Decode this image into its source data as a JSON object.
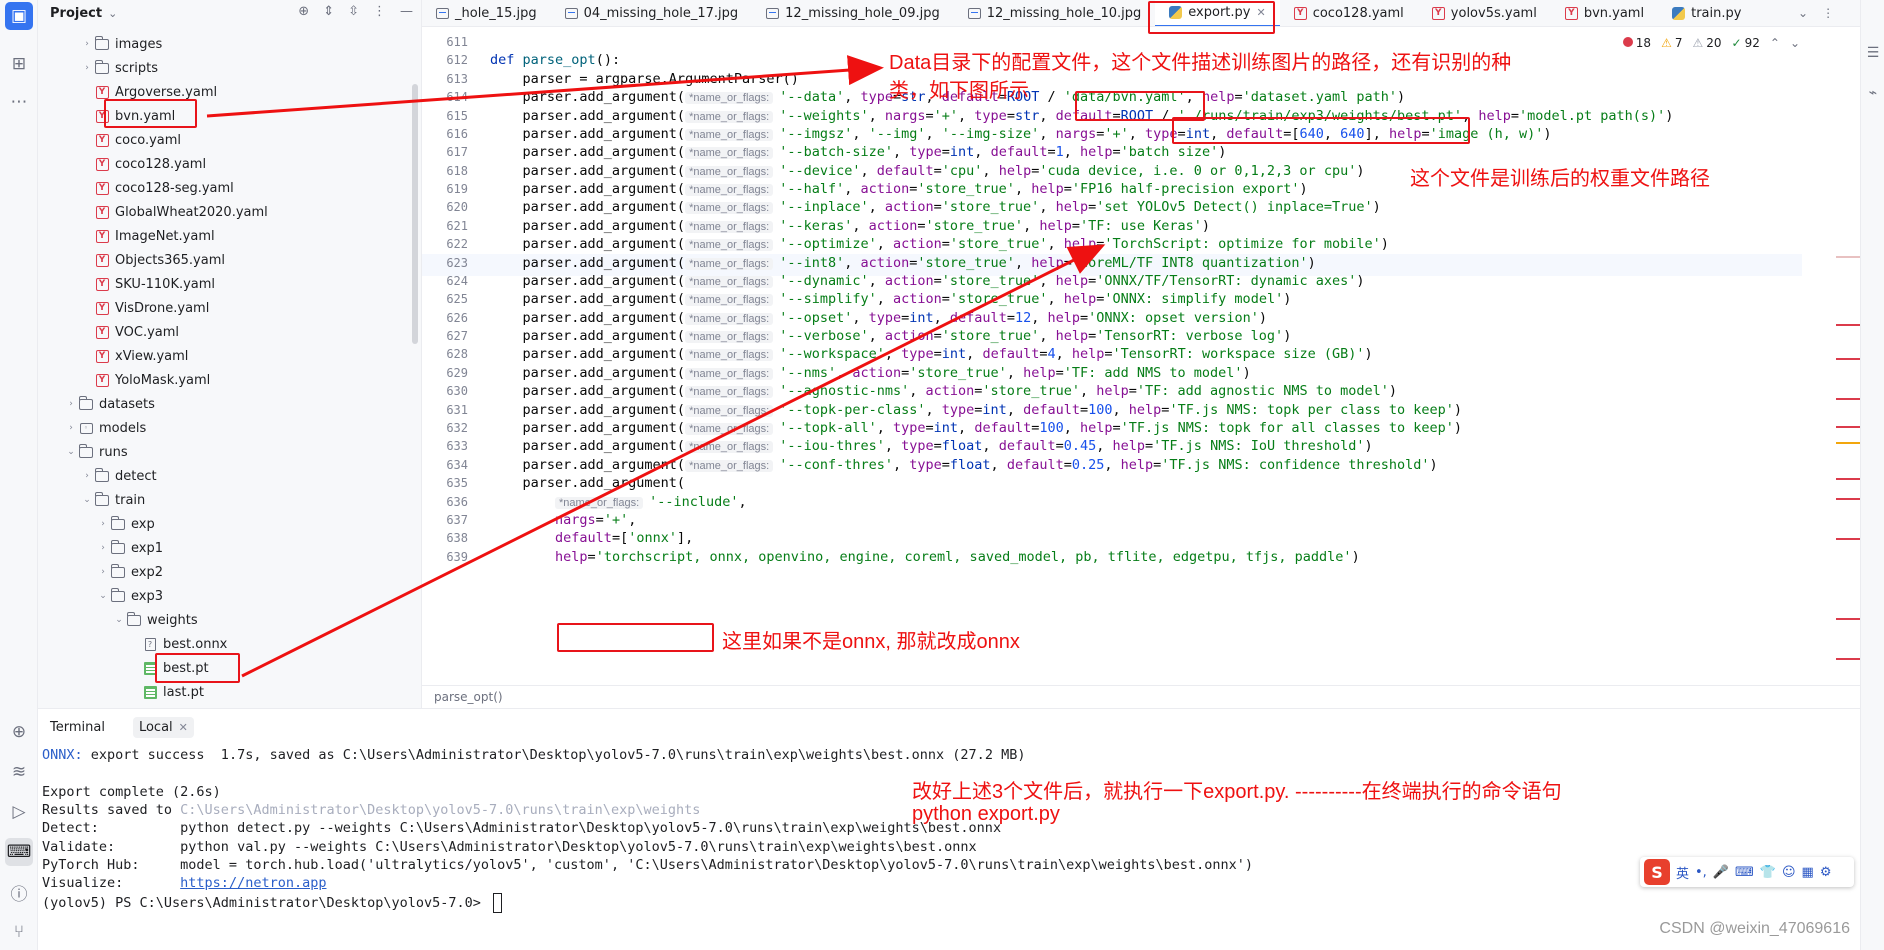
{
  "colors": {
    "accent": "#3574f0",
    "annotation": "#ee1111",
    "error": "#db3b4b",
    "warning": "#f2a60d",
    "ok": "#208a3c"
  },
  "project": {
    "title": "Project",
    "tree": [
      {
        "label": "images",
        "type": "folder",
        "depth": 3,
        "arrow": "›"
      },
      {
        "label": "scripts",
        "type": "folder",
        "depth": 3,
        "arrow": "›"
      },
      {
        "label": "Argoverse.yaml",
        "type": "yaml",
        "depth": 3
      },
      {
        "label": "bvn.yaml",
        "type": "yaml",
        "depth": 3
      },
      {
        "label": "coco.yaml",
        "type": "yaml",
        "depth": 3
      },
      {
        "label": "coco128.yaml",
        "type": "yaml",
        "depth": 3
      },
      {
        "label": "coco128-seg.yaml",
        "type": "yaml",
        "depth": 3
      },
      {
        "label": "GlobalWheat2020.yaml",
        "type": "yaml",
        "depth": 3
      },
      {
        "label": "ImageNet.yaml",
        "type": "yaml",
        "depth": 3
      },
      {
        "label": "Objects365.yaml",
        "type": "yaml",
        "depth": 3
      },
      {
        "label": "SKU-110K.yaml",
        "type": "yaml",
        "depth": 3
      },
      {
        "label": "VisDrone.yaml",
        "type": "yaml",
        "depth": 3
      },
      {
        "label": "VOC.yaml",
        "type": "yaml",
        "depth": 3
      },
      {
        "label": "xView.yaml",
        "type": "yaml",
        "depth": 3
      },
      {
        "label": "YoloMask.yaml",
        "type": "yaml",
        "depth": 3
      },
      {
        "label": "datasets",
        "type": "folder",
        "depth": 2,
        "arrow": "›"
      },
      {
        "label": "models",
        "type": "module",
        "depth": 2,
        "arrow": "›"
      },
      {
        "label": "runs",
        "type": "folder",
        "depth": 2,
        "arrow": "⌄"
      },
      {
        "label": "detect",
        "type": "folder",
        "depth": 3,
        "arrow": "›"
      },
      {
        "label": "train",
        "type": "folder",
        "depth": 3,
        "arrow": "⌄"
      },
      {
        "label": "exp",
        "type": "folder",
        "depth": 4,
        "arrow": "›"
      },
      {
        "label": "exp1",
        "type": "folder",
        "depth": 4,
        "arrow": "›"
      },
      {
        "label": "exp2",
        "type": "folder",
        "depth": 4,
        "arrow": "›"
      },
      {
        "label": "exp3",
        "type": "folder",
        "depth": 4,
        "arrow": "⌄"
      },
      {
        "label": "weights",
        "type": "folder",
        "depth": 5,
        "arrow": "⌄"
      },
      {
        "label": "best.onnx",
        "type": "unknown",
        "depth": 6
      },
      {
        "label": "best.pt",
        "type": "pt",
        "depth": 6
      },
      {
        "label": "last.pt",
        "type": "pt",
        "depth": 6
      }
    ]
  },
  "tabs": [
    {
      "label": "_hole_15.jpg",
      "icon": "image-icon"
    },
    {
      "label": "04_missing_hole_17.jpg",
      "icon": "image-icon"
    },
    {
      "label": "12_missing_hole_09.jpg",
      "icon": "image-icon"
    },
    {
      "label": "12_missing_hole_10.jpg",
      "icon": "image-icon"
    },
    {
      "label": "export.py",
      "icon": "python-icon",
      "active": true
    },
    {
      "label": "coco128.yaml",
      "icon": "yaml-icon"
    },
    {
      "label": "yolov5s.yaml",
      "icon": "yaml-icon"
    },
    {
      "label": "bvn.yaml",
      "icon": "yaml-icon"
    },
    {
      "label": "train.py",
      "icon": "python-icon"
    }
  ],
  "inspections": {
    "errors": "18",
    "warnings": "7",
    "weak": "20",
    "ok": "92"
  },
  "editor": {
    "breadcrumb": "parse_opt()",
    "hint": "*name_or_flags:",
    "lines": [
      {
        "n": "611",
        "t": ""
      },
      {
        "n": "612",
        "t": "def parse_opt():"
      },
      {
        "n": "613",
        "t": "    parser = argparse.ArgumentParser()"
      },
      {
        "n": "614",
        "a": "'--data', type=str, default=ROOT / 'data/bvn.yaml', help='dataset.yaml path')"
      },
      {
        "n": "615",
        "a": "'--weights', nargs='+', type=str, default=ROOT / './runs/train/exp3/weights/best.pt', help='model.pt path(s)')"
      },
      {
        "n": "616",
        "a": "'--imgsz', '--img', '--img-size', nargs='+', type=int, default=[640, 640], help='image (h, w)')"
      },
      {
        "n": "617",
        "a": "'--batch-size', type=int, default=1, help='batch size')"
      },
      {
        "n": "618",
        "a": "'--device', default='cpu', help='cuda device, i.e. 0 or 0,1,2,3 or cpu')"
      },
      {
        "n": "619",
        "a": "'--half', action='store_true', help='FP16 half-precision export')"
      },
      {
        "n": "620",
        "a": "'--inplace', action='store_true', help='set YOLOv5 Detect() inplace=True')"
      },
      {
        "n": "621",
        "a": "'--keras', action='store_true', help='TF: use Keras')"
      },
      {
        "n": "622",
        "a": "'--optimize', action='store_true', help='TorchScript: optimize for mobile')"
      },
      {
        "n": "623",
        "a": "'--int8', action='store_true', help='CoreML/TF INT8 quantization')"
      },
      {
        "n": "624",
        "a": "'--dynamic', action='store_true', help='ONNX/TF/TensorRT: dynamic axes')"
      },
      {
        "n": "625",
        "a": "'--simplify', action='store_true', help='ONNX: simplify model')"
      },
      {
        "n": "626",
        "a": "'--opset', type=int, default=12, help='ONNX: opset version')"
      },
      {
        "n": "627",
        "a": "'--verbose', action='store_true', help='TensorRT: verbose log')"
      },
      {
        "n": "628",
        "a": "'--workspace', type=int, default=4, help='TensorRT: workspace size (GB)')"
      },
      {
        "n": "629",
        "a": "'--nms', action='store_true', help='TF: add NMS to model')"
      },
      {
        "n": "630",
        "a": "'--agnostic-nms', action='store_true', help='TF: add agnostic NMS to model')"
      },
      {
        "n": "631",
        "a": "'--topk-per-class', type=int, default=100, help='TF.js NMS: topk per class to keep')"
      },
      {
        "n": "632",
        "a": "'--topk-all', type=int, default=100, help='TF.js NMS: topk for all classes to keep')"
      },
      {
        "n": "633",
        "a": "'--iou-thres', type=float, default=0.45, help='TF.js NMS: IoU threshold')"
      },
      {
        "n": "634",
        "a": "'--conf-thres', type=float, default=0.25, help='TF.js NMS: confidence threshold')"
      },
      {
        "n": "635",
        "t": "    parser.add_argument("
      },
      {
        "n": "636",
        "h": true,
        "t": "'--include',"
      },
      {
        "n": "637",
        "t": "        nargs='+',"
      },
      {
        "n": "638",
        "t": "        default=['onnx'],"
      },
      {
        "n": "639",
        "t": "        help='torchscript, onnx, openvino, engine, coreml, saved_model, pb, tflite, edgetpu, tfjs, paddle')"
      }
    ],
    "call_prefix": "    parser.add_argument("
  },
  "terminal": {
    "tab_title": "Terminal",
    "tab_local": "Local",
    "lines": [
      {
        "t": "ONNX: export success  1.7s, saved as C:\\Users\\Administrator\\Desktop\\yolov5-7.0\\runs\\train\\exp\\weights\\best.onnx (27.2 MB)"
      },
      {
        "t": ""
      },
      {
        "t": "Export complete (2.6s)"
      },
      {
        "t": "Results saved to ",
        "dim": "C:\\Users\\Administrator\\Desktop\\yolov5-7.0\\runs\\train\\exp\\weights"
      },
      {
        "t": "Detect:          python detect.py --weights C:\\Users\\Administrator\\Desktop\\yolov5-7.0\\runs\\train\\exp\\weights\\best.onnx"
      },
      {
        "t": "Validate:        python val.py --weights C:\\Users\\Administrator\\Desktop\\yolov5-7.0\\runs\\train\\exp\\weights\\best.onnx"
      },
      {
        "t": "PyTorch Hub:     model = torch.hub.load('ultralytics/yolov5', 'custom', 'C:\\Users\\Administrator\\Desktop\\yolov5-7.0\\runs\\train\\exp\\weights\\best.onnx')"
      },
      {
        "t": "Visualize:       ",
        "link": "https://netron.app"
      },
      {
        "t": "(yolov5) PS C:\\Users\\Administrator\\Desktop\\yolov5-7.0> "
      }
    ]
  },
  "annotations": {
    "data_note_1": "Data目录下的配置文件，这个文件描述训练图片的路径，还有识别的种",
    "data_note_2": "类，如下图所示",
    "weights_note": "这个文件是训练后的权重文件路径",
    "onnx_note": "这里如果不是onnx, 那就改成onnx",
    "run_note": "改好上述3个文件后，就执行一下export.py.      ----------在终端执行的命令语句",
    "run_cmd": "python export.py"
  },
  "ime": {
    "lang": "英"
  },
  "watermark": "CSDN @weixin_47069616"
}
